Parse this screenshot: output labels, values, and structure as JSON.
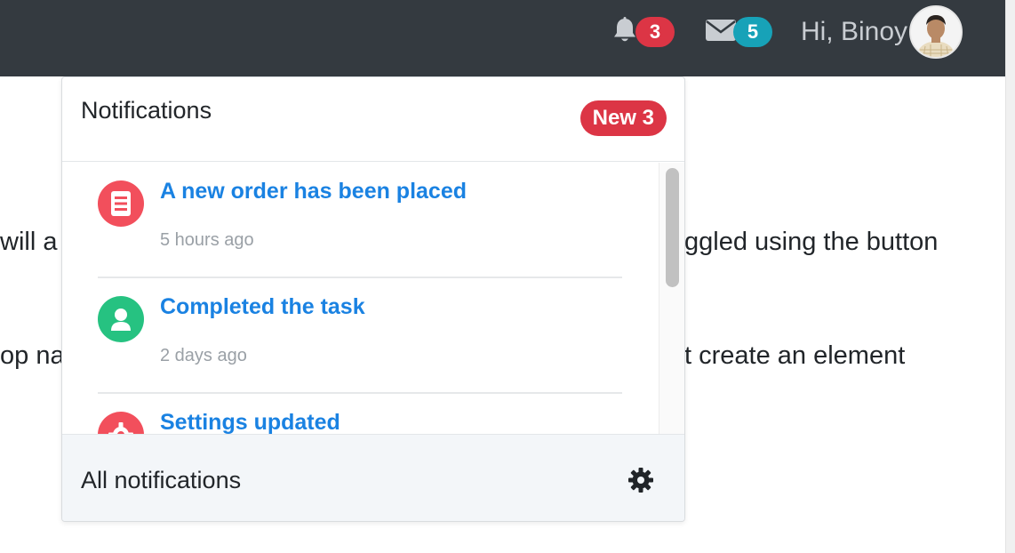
{
  "navbar": {
    "notifications_count": "3",
    "messages_count": "5",
    "greeting": "Hi, Binoy",
    "colors": {
      "background": "#343a40",
      "badge_red": "#dc3545",
      "badge_teal": "#17a2b8"
    }
  },
  "background_text": {
    "line1_left": "will a",
    "line1_right": "ggled using the button",
    "line2_left": "op na",
    "line2_right": "t create an element"
  },
  "dropdown": {
    "title": "Notifications",
    "new_badge": "New 3",
    "items": [
      {
        "title": "A new order has been placed",
        "time": "5 hours ago",
        "icon": "document-icon",
        "icon_color": "#f24f5c"
      },
      {
        "title": "Completed the task",
        "time": "2 days ago",
        "icon": "user-icon",
        "icon_color": "#26c281"
      },
      {
        "title": "Settings updated",
        "time": "",
        "icon": "gear-icon",
        "icon_color": "#f24f5c"
      }
    ],
    "footer_label": "All notifications",
    "footer_icon": "gear-icon"
  }
}
